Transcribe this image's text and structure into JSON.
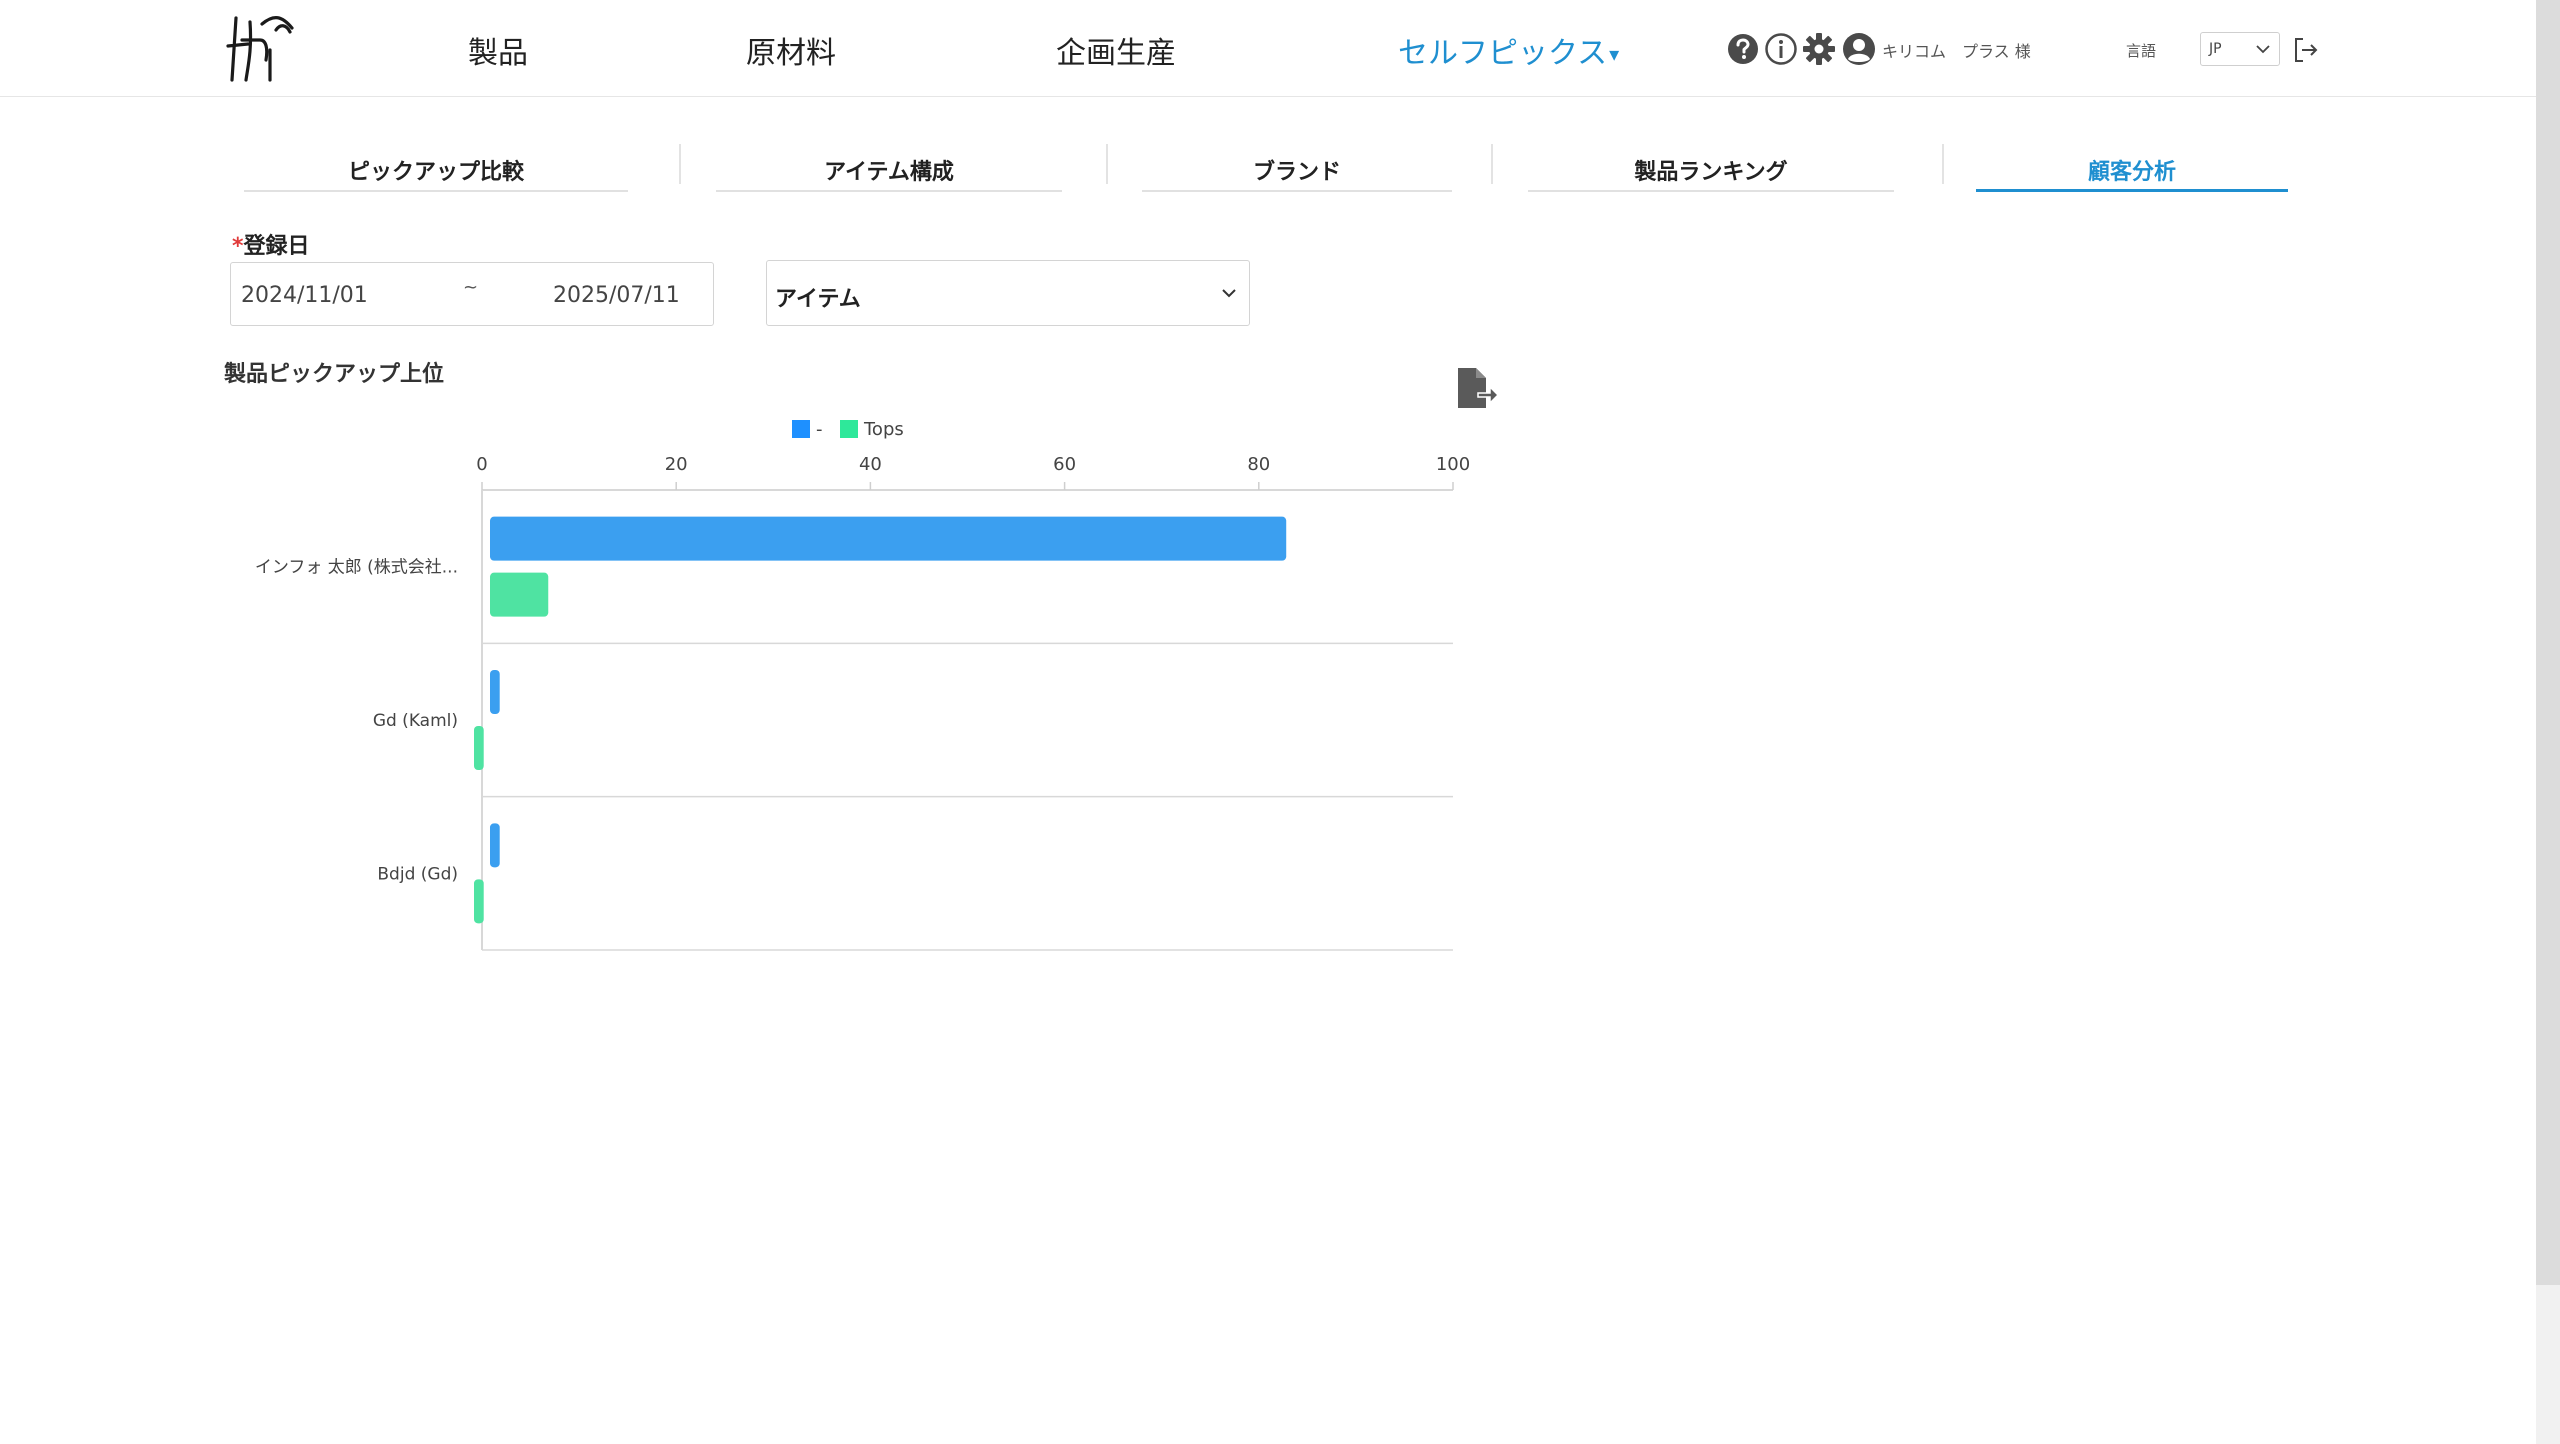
{
  "header": {
    "nav": {
      "products": "製品",
      "materials": "原材料",
      "planning": "企画生産",
      "selfpicks": "セルフピックス",
      "selfpicks_caret": "▾"
    },
    "user_name": "キリコム",
    "user_company": "プラス 様",
    "language_label": "言語",
    "language_value": "JP"
  },
  "tabs": [
    {
      "label": "ピックアップ比較",
      "active": false
    },
    {
      "label": "アイテム構成",
      "active": false
    },
    {
      "label": "ブランド",
      "active": false
    },
    {
      "label": "製品ランキング",
      "active": false
    },
    {
      "label": "顧客分析",
      "active": true
    }
  ],
  "filters": {
    "date_label": "登録日",
    "required_mark": "*",
    "date_start": "2024/11/01",
    "date_separator": "~",
    "date_end": "2025/07/11",
    "item_select": "アイテム"
  },
  "chart_data": {
    "type": "bar",
    "orientation": "horizontal",
    "title": "製品ピックアップ上位",
    "categories": [
      "インフォ 太郎 (株式会社...",
      "Gd (Kaml)",
      "Bdjd (Gd)"
    ],
    "series": [
      {
        "name": "-",
        "color": "#3b9ff0",
        "values": [
          82,
          1,
          1
        ]
      },
      {
        "name": "Tops",
        "color": "#4fe3a2",
        "values": [
          6,
          1,
          1
        ]
      }
    ],
    "xlim": [
      0,
      100
    ],
    "xticks": [
      0,
      20,
      40,
      60,
      80,
      100
    ],
    "legend_position": "top",
    "xaxis_position": "top"
  }
}
